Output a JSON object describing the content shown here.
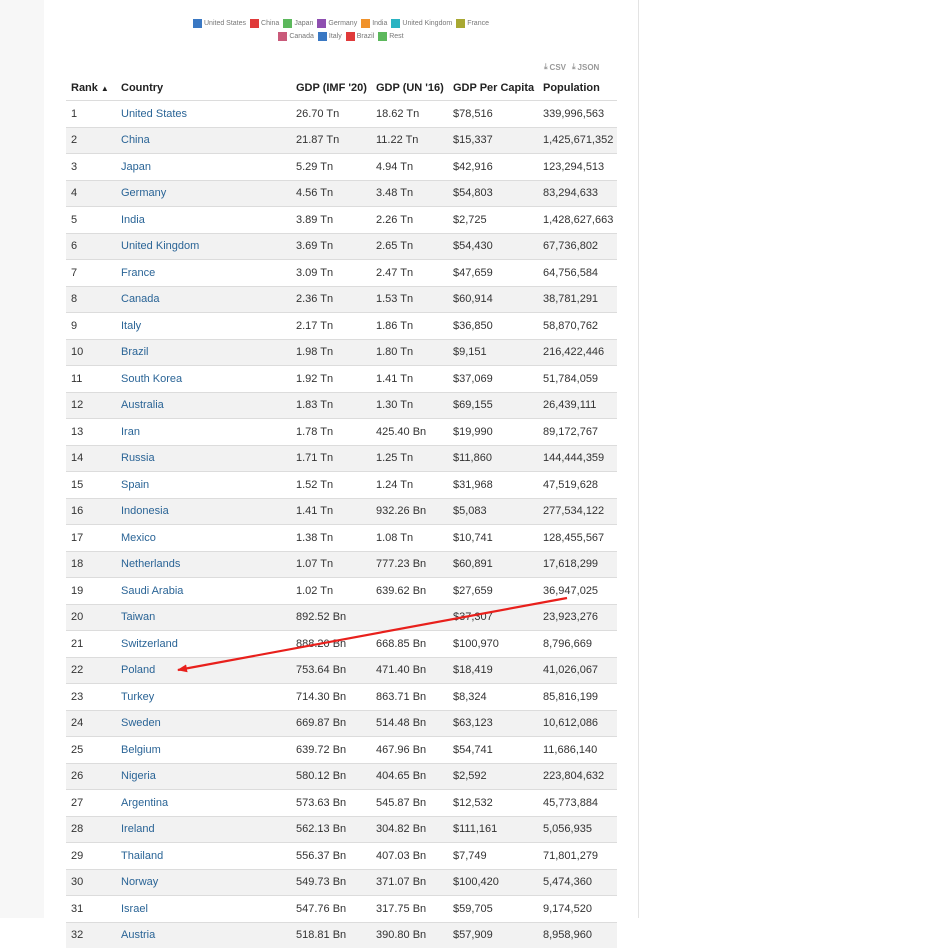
{
  "legend": {
    "row1": [
      {
        "label": "United States",
        "color": "#3a78c3"
      },
      {
        "label": "China",
        "color": "#e03a3a"
      },
      {
        "label": "Japan",
        "color": "#5cb85c"
      },
      {
        "label": "Germany",
        "color": "#8e4fb0"
      },
      {
        "label": "India",
        "color": "#f0922b"
      },
      {
        "label": "United Kingdom",
        "color": "#2ab3c2"
      },
      {
        "label": "France",
        "color": "#a8a832"
      }
    ],
    "row2": [
      {
        "label": "Canada",
        "color": "#c95a7a"
      },
      {
        "label": "Italy",
        "color": "#3a78c3"
      },
      {
        "label": "Brazil",
        "color": "#e03a3a"
      },
      {
        "label": "Rest",
        "color": "#5cb85c"
      }
    ]
  },
  "export": {
    "csv": "CSV",
    "json": "JSON",
    "icon": "download-icon"
  },
  "table": {
    "headers": {
      "rank": "Rank",
      "country": "Country",
      "gdp_imf": "GDP (IMF '20)",
      "gdp_un": "GDP (UN '16)",
      "gdp_per_capita": "GDP Per Capita",
      "population": "Population"
    },
    "sort_indicator": "▲",
    "rows": [
      [
        "1",
        "United States",
        "26.70 Tn",
        "18.62 Tn",
        "$78,516",
        "339,996,563"
      ],
      [
        "2",
        "China",
        "21.87 Tn",
        "11.22 Tn",
        "$15,337",
        "1,425,671,352"
      ],
      [
        "3",
        "Japan",
        "5.29 Tn",
        "4.94 Tn",
        "$42,916",
        "123,294,513"
      ],
      [
        "4",
        "Germany",
        "4.56 Tn",
        "3.48 Tn",
        "$54,803",
        "83,294,633"
      ],
      [
        "5",
        "India",
        "3.89 Tn",
        "2.26 Tn",
        "$2,725",
        "1,428,627,663"
      ],
      [
        "6",
        "United Kingdom",
        "3.69 Tn",
        "2.65 Tn",
        "$54,430",
        "67,736,802"
      ],
      [
        "7",
        "France",
        "3.09 Tn",
        "2.47 Tn",
        "$47,659",
        "64,756,584"
      ],
      [
        "8",
        "Canada",
        "2.36 Tn",
        "1.53 Tn",
        "$60,914",
        "38,781,291"
      ],
      [
        "9",
        "Italy",
        "2.17 Tn",
        "1.86 Tn",
        "$36,850",
        "58,870,762"
      ],
      [
        "10",
        "Brazil",
        "1.98 Tn",
        "1.80 Tn",
        "$9,151",
        "216,422,446"
      ],
      [
        "11",
        "South Korea",
        "1.92 Tn",
        "1.41 Tn",
        "$37,069",
        "51,784,059"
      ],
      [
        "12",
        "Australia",
        "1.83 Tn",
        "1.30 Tn",
        "$69,155",
        "26,439,111"
      ],
      [
        "13",
        "Iran",
        "1.78 Tn",
        "425.40 Bn",
        "$19,990",
        "89,172,767"
      ],
      [
        "14",
        "Russia",
        "1.71 Tn",
        "1.25 Tn",
        "$11,860",
        "144,444,359"
      ],
      [
        "15",
        "Spain",
        "1.52 Tn",
        "1.24 Tn",
        "$31,968",
        "47,519,628"
      ],
      [
        "16",
        "Indonesia",
        "1.41 Tn",
        "932.26 Bn",
        "$5,083",
        "277,534,122"
      ],
      [
        "17",
        "Mexico",
        "1.38 Tn",
        "1.08 Tn",
        "$10,741",
        "128,455,567"
      ],
      [
        "18",
        "Netherlands",
        "1.07 Tn",
        "777.23 Bn",
        "$60,891",
        "17,618,299"
      ],
      [
        "19",
        "Saudi Arabia",
        "1.02 Tn",
        "639.62 Bn",
        "$27,659",
        "36,947,025"
      ],
      [
        "20",
        "Taiwan",
        "892.52 Bn",
        "",
        "$37,307",
        "23,923,276"
      ],
      [
        "21",
        "Switzerland",
        "888.20 Bn",
        "668.85 Bn",
        "$100,970",
        "8,796,669"
      ],
      [
        "22",
        "Poland",
        "753.64 Bn",
        "471.40 Bn",
        "$18,419",
        "41,026,067"
      ],
      [
        "23",
        "Turkey",
        "714.30 Bn",
        "863.71 Bn",
        "$8,324",
        "85,816,199"
      ],
      [
        "24",
        "Sweden",
        "669.87 Bn",
        "514.48 Bn",
        "$63,123",
        "10,612,086"
      ],
      [
        "25",
        "Belgium",
        "639.72 Bn",
        "467.96 Bn",
        "$54,741",
        "11,686,140"
      ],
      [
        "26",
        "Nigeria",
        "580.12 Bn",
        "404.65 Bn",
        "$2,592",
        "223,804,632"
      ],
      [
        "27",
        "Argentina",
        "573.63 Bn",
        "545.87 Bn",
        "$12,532",
        "45,773,884"
      ],
      [
        "28",
        "Ireland",
        "562.13 Bn",
        "304.82 Bn",
        "$111,161",
        "5,056,935"
      ],
      [
        "29",
        "Thailand",
        "556.37 Bn",
        "407.03 Bn",
        "$7,749",
        "71,801,279"
      ],
      [
        "30",
        "Norway",
        "549.73 Bn",
        "371.07 Bn",
        "$100,420",
        "5,474,360"
      ],
      [
        "31",
        "Israel",
        "547.76 Bn",
        "317.75 Bn",
        "$59,705",
        "9,174,520"
      ],
      [
        "32",
        "Austria",
        "518.81 Bn",
        "390.80 Bn",
        "$57,909",
        "8,958,960"
      ]
    ]
  },
  "annotation": {
    "color": "#e8201c",
    "icon": "red-arrow-annotation"
  }
}
